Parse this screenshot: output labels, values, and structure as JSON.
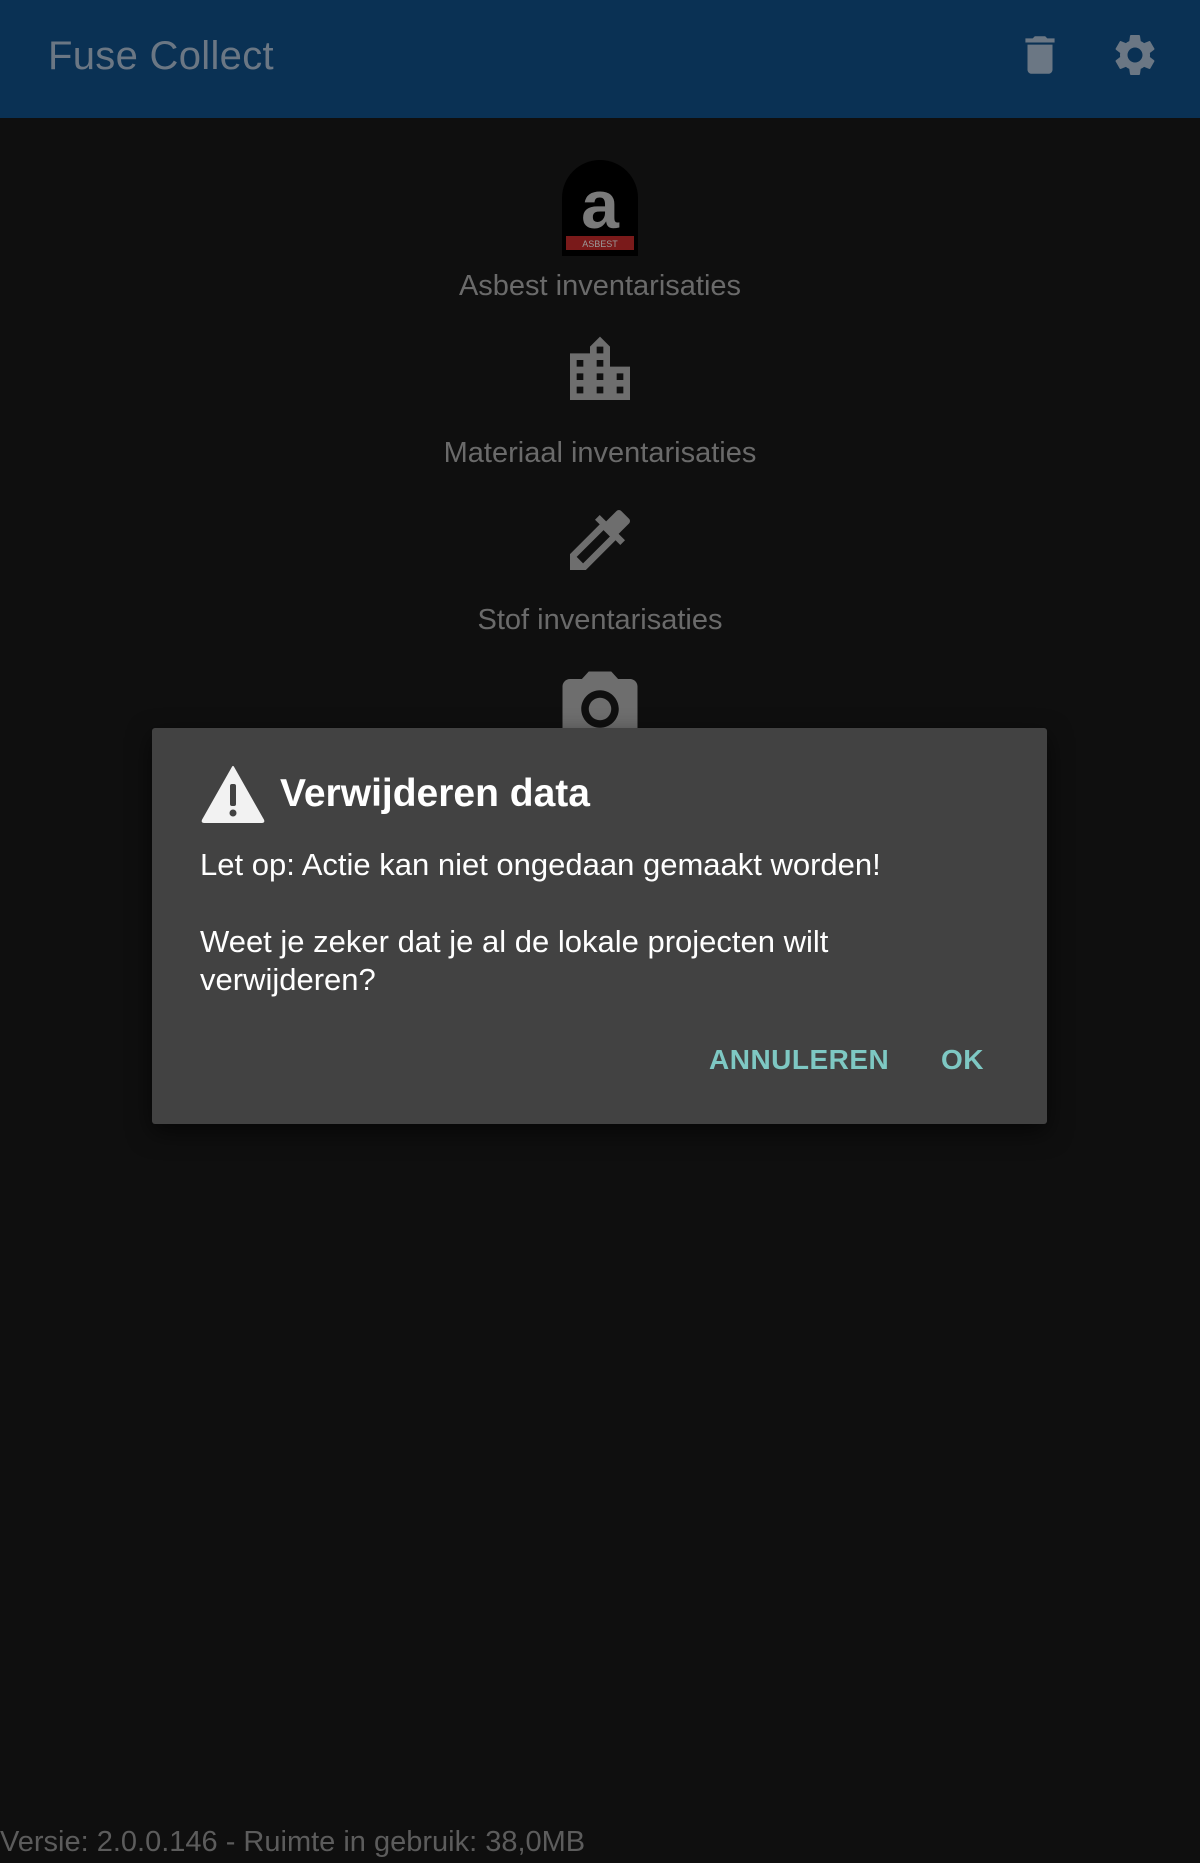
{
  "appbar": {
    "title": "Fuse Collect",
    "delete_icon": "trash-icon",
    "settings_icon": "gear-icon"
  },
  "menu": {
    "items": [
      {
        "label": "Asbest inventarisaties",
        "icon": "asbest-logo-icon",
        "logo_text": "a",
        "logo_badge": "ASBEST"
      },
      {
        "label": "Materiaal inventarisaties",
        "icon": "building-icon"
      },
      {
        "label": "Stof inventarisaties",
        "icon": "eyedropper-icon"
      },
      {
        "label": "",
        "icon": "camera-icon"
      }
    ]
  },
  "footer": {
    "text": "Versie: 2.0.0.146 - Ruimte in gebruik: 38,0MB"
  },
  "dialog": {
    "icon": "warning-icon",
    "title": "Verwijderen data",
    "message_line1": "Let op: Actie kan niet ongedaan gemaakt worden!",
    "message_line2": "Weet je zeker dat je al de lokale projecten wilt verwijderen?",
    "cancel_label": "ANNULEREN",
    "ok_label": "OK"
  },
  "colors": {
    "appbar": "#0a3154",
    "background": "#0f0f0f",
    "dialog": "#424242",
    "accent": "#7ec8c3"
  }
}
